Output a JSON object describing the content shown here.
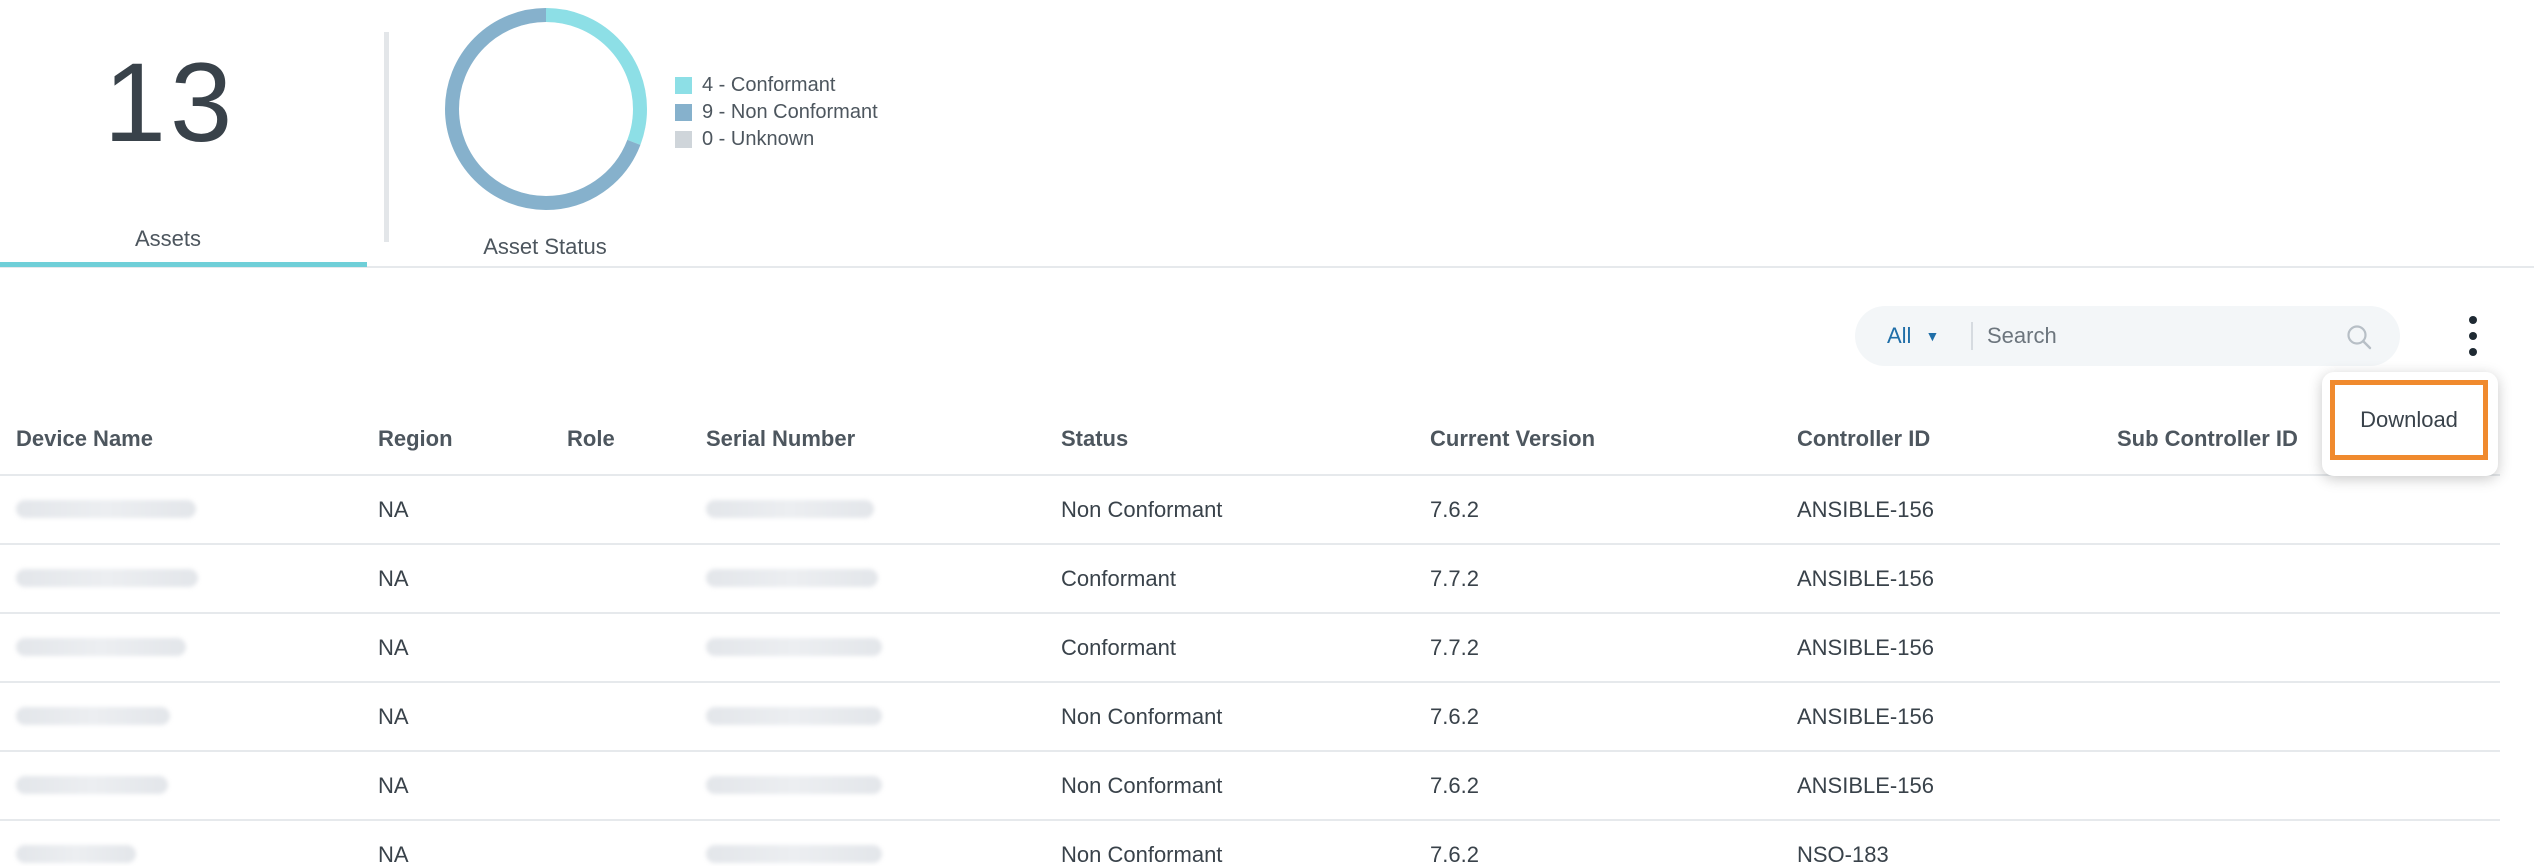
{
  "summary": {
    "assets": {
      "count": "13",
      "label": "Assets"
    },
    "asset_status": {
      "label": "Asset Status",
      "legend": [
        {
          "text": "4 - Conformant",
          "value": 4,
          "color": "#8ddfe6"
        },
        {
          "text": "9 - Non Conformant",
          "value": 9,
          "color": "#86b1cc"
        },
        {
          "text": "0 - Unknown",
          "value": 0,
          "color": "#cfd5da"
        }
      ]
    }
  },
  "toolbar": {
    "filter_value": "All",
    "search_placeholder": "Search",
    "menu": {
      "download_label": "Download"
    }
  },
  "table": {
    "columns": [
      "Device Name",
      "Region",
      "Role",
      "Serial Number",
      "Status",
      "Current Version",
      "Controller ID",
      "Sub Controller ID"
    ],
    "rows": [
      {
        "region": "NA",
        "role": "",
        "status": "Non Conformant",
        "version": "7.6.2",
        "controller": "ANSIBLE-156",
        "sub_controller": ""
      },
      {
        "region": "NA",
        "role": "",
        "status": "Conformant",
        "version": "7.7.2",
        "controller": "ANSIBLE-156",
        "sub_controller": ""
      },
      {
        "region": "NA",
        "role": "",
        "status": "Conformant",
        "version": "7.7.2",
        "controller": "ANSIBLE-156",
        "sub_controller": ""
      },
      {
        "region": "NA",
        "role": "",
        "status": "Non Conformant",
        "version": "7.6.2",
        "controller": "ANSIBLE-156",
        "sub_controller": ""
      },
      {
        "region": "NA",
        "role": "",
        "status": "Non Conformant",
        "version": "7.6.2",
        "controller": "ANSIBLE-156",
        "sub_controller": ""
      },
      {
        "region": "NA",
        "role": "",
        "status": "Non Conformant",
        "version": "7.6.2",
        "controller": "NSO-183",
        "sub_controller": ""
      }
    ]
  }
}
